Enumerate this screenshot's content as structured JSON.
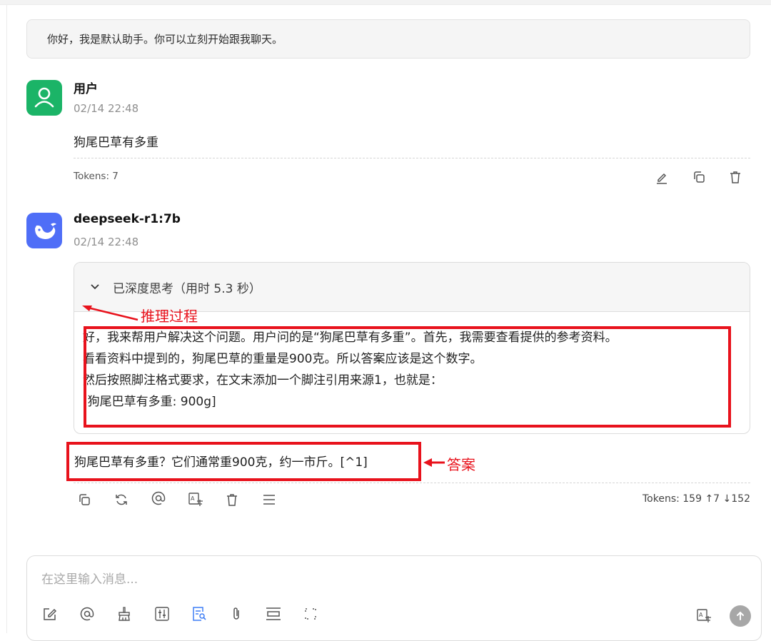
{
  "welcome": "你好，我是默认助手。你可以立刻开始跟我聊天。",
  "user_message": {
    "name": "用户",
    "time": "02/14 22:48",
    "text": "狗尾巴草有多重",
    "tokens": "Tokens: 7",
    "avatar_icon": "user-icon",
    "avatar_color": "#1bb467",
    "actions": [
      "edit-icon",
      "copy-icon",
      "trash-icon"
    ]
  },
  "bot_message": {
    "name": "deepseek-r1:7b",
    "time": "02/14 22:48",
    "avatar_icon": "deepseek-whale-icon",
    "avatar_color": "#4f6ef7",
    "thinking": {
      "header": "已深度思考（用时 5.3 秒）",
      "lines": [
        "好，我来帮用户解决这个问题。用户问的是“狗尾巴草有多重”。首先，我需要查看提供的参考资料。",
        "看看资料中提到的，狗尾巴草的重量是900克。所以答案应该是这个数字。",
        "然后按照脚注格式要求，在文末添加一个脚注引用来源1，也就是：",
        "[狗尾巴草有多重: 900g]"
      ]
    },
    "answer": "狗尾巴草有多重？它们通常重900克，约一市斤。[^1]",
    "tokens": "Tokens: 159 ↑7 ↓152",
    "actions": [
      "copy-icon",
      "refresh-icon",
      "at-icon",
      "translate-icon",
      "trash-icon",
      "menu-icon"
    ]
  },
  "annotations": {
    "reasoning_label": "推理过程",
    "answer_label": "答案",
    "color": "#e8121c"
  },
  "input": {
    "placeholder": "在这里输入消息...",
    "value": "",
    "tools": [
      "edit-icon",
      "at-icon",
      "clear-icon",
      "settings-sliders-icon",
      "search-doc-icon",
      "paperclip-icon",
      "divider-icon",
      "expand-icon"
    ],
    "right_tools": [
      "translate-icon",
      "send-icon"
    ]
  }
}
